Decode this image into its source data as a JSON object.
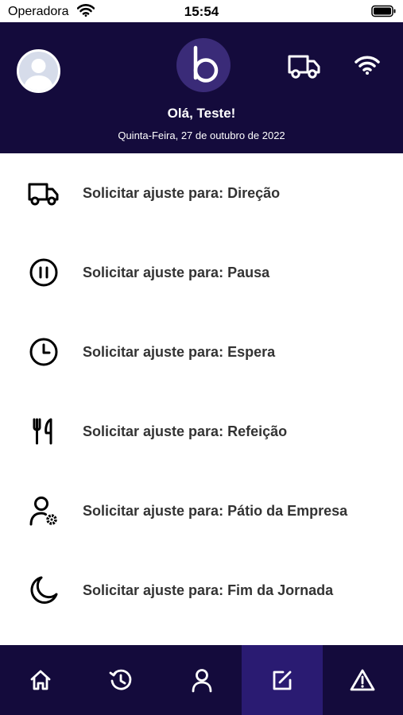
{
  "status_bar": {
    "carrier": "Operadora",
    "time": "15:54"
  },
  "header": {
    "greeting": "Olá, Teste!",
    "date": "Quinta-Feira, 27 de outubro de 2022",
    "background_color": "#140b3c"
  },
  "adjust_list": {
    "items": [
      {
        "icon": "truck-icon",
        "label": "Solicitar ajuste para: Direção"
      },
      {
        "icon": "pause-circle-icon",
        "label": "Solicitar ajuste para: Pausa"
      },
      {
        "icon": "clock-icon",
        "label": "Solicitar ajuste para: Espera"
      },
      {
        "icon": "fork-knife-icon",
        "label": "Solicitar ajuste para: Refeição"
      },
      {
        "icon": "user-gear-icon",
        "label": "Solicitar ajuste para: Pátio da Empresa"
      },
      {
        "icon": "moon-icon",
        "label": "Solicitar ajuste para: Fim da Jornada"
      }
    ]
  },
  "bottom_nav": {
    "items": [
      {
        "icon": "home-icon",
        "active": false
      },
      {
        "icon": "history-icon",
        "active": false
      },
      {
        "icon": "profile-icon",
        "active": false
      },
      {
        "icon": "edit-icon",
        "active": true
      },
      {
        "icon": "warning-icon",
        "active": false
      }
    ],
    "active_color": "#2a1b72"
  }
}
